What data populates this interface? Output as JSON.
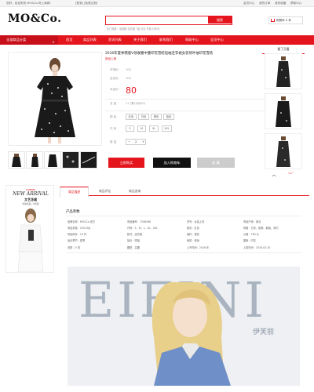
{
  "topbar": {
    "left_text": "您好，欢迎来到 MO&Co 网上商城!",
    "mid_text": "[登录] [免费注册]",
    "links": [
      "会员中心",
      "我的订单",
      "我的收藏",
      "帮助中心"
    ]
  },
  "header": {
    "logo": "MO&Co.",
    "search_placeholder": "",
    "search_button": "搜索",
    "hot_words": "热门搜索：羽绒服  连衣裙  T恤  衬衫  外套  针织衫",
    "cart_label": "购物车 0 件"
  },
  "nav": {
    "category_label": "全部商品分类",
    "items": [
      "首页",
      "商品列表",
      "资讯列表",
      "关于我们",
      "联系我们",
      "帮助中心",
      "会员中心"
    ]
  },
  "product": {
    "title": "2016年夏季韩版V领收腰中腰印花雪纺短袖连衣裙女装荷叶袖印花雪纺",
    "subtitle": "新品上架",
    "original_price_label": "市场价：",
    "original_price": "100",
    "member_price_label": "会员价：",
    "member_price": "100",
    "price_label": "本店价：",
    "price": "80",
    "sales_label": "总 量",
    "sales_value": "21 (累计评价0)",
    "color_label": "颜 色",
    "colors": [
      "红色",
      "白色",
      "黑色",
      "蓝色"
    ],
    "size_label": "尺 码",
    "sizes": [
      "S",
      "M",
      "XL",
      "XXL"
    ],
    "qty_label": "数 量",
    "qty_minus": "−",
    "qty_value": "2",
    "qty_plus": "+",
    "buy_now": "立即购买",
    "add_cart": "加入购物车",
    "favorite": "收 藏"
  },
  "recommend": {
    "title": "看了又看"
  },
  "ad": {
    "small": "SUMMER",
    "big": "NEW ARRIVAL",
    "cn": "文艺花裙",
    "sub": "时尚女装 / 5折起"
  },
  "tabs": [
    "商品描述",
    "商品评论",
    "商品咨询"
  ],
  "params": {
    "title": "产品参数",
    "rows": [
      [
        "品牌名称：MO&Co 官方",
        "商品编号：7346498",
        "货号：女装上衣",
        "商品产地：湖北"
      ],
      [
        "商品重量：250.00g",
        "尺码：S、M、L、XL、XXL",
        "颜色：红色",
        "风格：日系、欧美、韩版、简约"
      ],
      [
        "商品库存：19 件",
        "款式：连衣裙",
        "面料：雪纺",
        "价格：780 元"
      ],
      [
        "适合季节：夏季",
        "袖长：短袖",
        "版型：修身",
        "图案：印花"
      ],
      [
        "领型：V 领",
        "腰型：高腰",
        "上市时间：2016 年",
        "上架时间：2016-03-20"
      ]
    ]
  },
  "banner": {
    "big_letters": "EIFINI",
    "cn_brand": "伊芙丽"
  },
  "colors": {
    "brand_red": "#e4151d",
    "dark": "#111111"
  }
}
